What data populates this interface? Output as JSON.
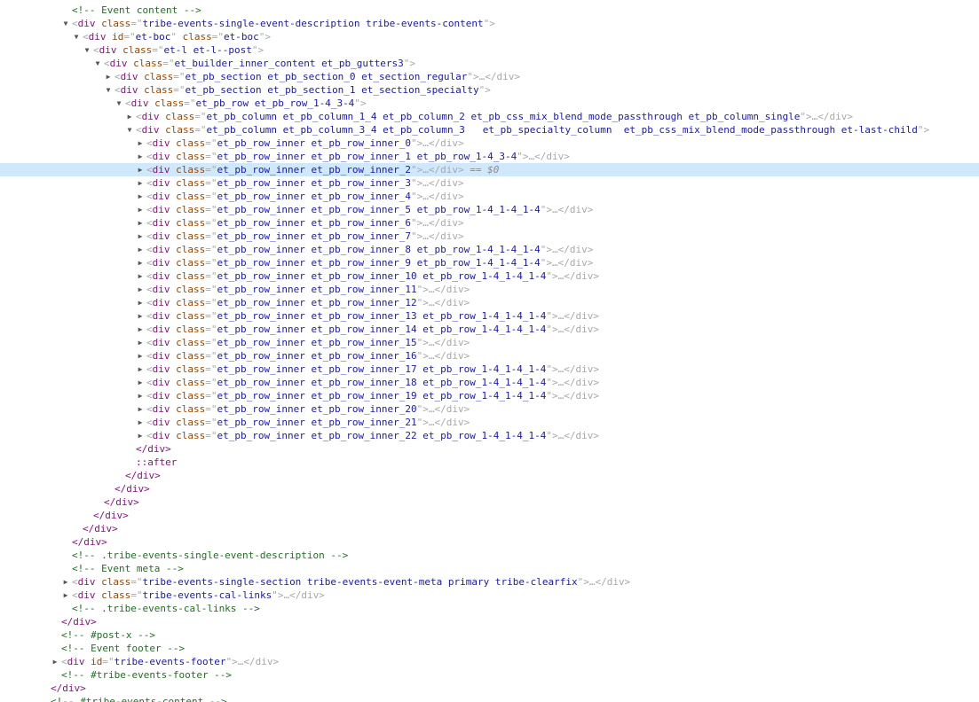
{
  "rows": [
    {
      "kind": "cm",
      "text": "<!-- Event content -->"
    },
    {
      "kind": "el",
      "toggle": "open",
      "tag": "div",
      "attrs": [
        {
          "n": "class",
          "v": "tribe-events-single-event-description tribe-events-content"
        }
      ],
      "end": ">"
    },
    {
      "kind": "el",
      "toggle": "open",
      "tag": "div",
      "attrs": [
        {
          "n": "id",
          "v": "et-boc"
        },
        {
          "n": "class",
          "v": "et-boc"
        }
      ],
      "end": ">"
    },
    {
      "kind": "el",
      "toggle": "open",
      "tag": "div",
      "attrs": [
        {
          "n": "class",
          "v": "et-l et-l--post"
        }
      ],
      "end": ">"
    },
    {
      "kind": "el",
      "toggle": "open",
      "tag": "div",
      "attrs": [
        {
          "n": "class",
          "v": "et_builder_inner_content et_pb_gutters3"
        }
      ],
      "end": ">"
    },
    {
      "kind": "el",
      "toggle": "closed",
      "tag": "div",
      "attrs": [
        {
          "n": "class",
          "v": "et_pb_section et_pb_section_0 et_section_regular"
        }
      ],
      "end": ">…</div>"
    },
    {
      "kind": "el",
      "toggle": "open",
      "tag": "div",
      "attrs": [
        {
          "n": "class",
          "v": "et_pb_section et_pb_section_1 et_section_specialty"
        }
      ],
      "end": ">"
    },
    {
      "kind": "el",
      "toggle": "open",
      "tag": "div",
      "attrs": [
        {
          "n": "class",
          "v": "et_pb_row et_pb_row_1-4_3-4"
        }
      ],
      "end": ">"
    },
    {
      "kind": "el",
      "toggle": "closed",
      "tag": "div",
      "attrs": [
        {
          "n": "class",
          "v": "et_pb_column et_pb_column_1_4 et_pb_column_2 et_pb_css_mix_blend_mode_passthrough et_pb_column_single"
        }
      ],
      "end": ">…</div>"
    },
    {
      "kind": "el",
      "toggle": "open",
      "tag": "div",
      "attrs": [
        {
          "n": "class",
          "v": "et_pb_column et_pb_column_3_4 et_pb_column_3   et_pb_specialty_column  et_pb_css_mix_blend_mode_passthrough et-last-child"
        }
      ],
      "end": ">"
    },
    {
      "kind": "el",
      "toggle": "closed",
      "tag": "div",
      "attrs": [
        {
          "n": "class",
          "v": "et_pb_row_inner et_pb_row_inner_0"
        }
      ],
      "end": ">…</div>"
    },
    {
      "kind": "el",
      "toggle": "closed",
      "tag": "div",
      "attrs": [
        {
          "n": "class",
          "v": "et_pb_row_inner et_pb_row_inner_1 et_pb_row_1-4_3-4"
        }
      ],
      "end": ">…</div>"
    },
    {
      "kind": "el",
      "toggle": "closed",
      "tag": "div",
      "attrs": [
        {
          "n": "class",
          "v": "et_pb_row_inner et_pb_row_inner_2"
        }
      ],
      "end": ">…</div>",
      "suffix": " == $0",
      "selected": true
    },
    {
      "kind": "el",
      "toggle": "closed",
      "tag": "div",
      "attrs": [
        {
          "n": "class",
          "v": "et_pb_row_inner et_pb_row_inner_3"
        }
      ],
      "end": ">…</div>"
    },
    {
      "kind": "el",
      "toggle": "closed",
      "tag": "div",
      "attrs": [
        {
          "n": "class",
          "v": "et_pb_row_inner et_pb_row_inner_4"
        }
      ],
      "end": ">…</div>"
    },
    {
      "kind": "el",
      "toggle": "closed",
      "tag": "div",
      "attrs": [
        {
          "n": "class",
          "v": "et_pb_row_inner et_pb_row_inner_5 et_pb_row_1-4_1-4_1-4"
        }
      ],
      "end": ">…</div>"
    },
    {
      "kind": "el",
      "toggle": "closed",
      "tag": "div",
      "attrs": [
        {
          "n": "class",
          "v": "et_pb_row_inner et_pb_row_inner_6"
        }
      ],
      "end": ">…</div>"
    },
    {
      "kind": "el",
      "toggle": "closed",
      "tag": "div",
      "attrs": [
        {
          "n": "class",
          "v": "et_pb_row_inner et_pb_row_inner_7"
        }
      ],
      "end": ">…</div>"
    },
    {
      "kind": "el",
      "toggle": "closed",
      "tag": "div",
      "attrs": [
        {
          "n": "class",
          "v": "et_pb_row_inner et_pb_row_inner_8 et_pb_row_1-4_1-4_1-4"
        }
      ],
      "end": ">…</div>"
    },
    {
      "kind": "el",
      "toggle": "closed",
      "tag": "div",
      "attrs": [
        {
          "n": "class",
          "v": "et_pb_row_inner et_pb_row_inner_9 et_pb_row_1-4_1-4_1-4"
        }
      ],
      "end": ">…</div>"
    },
    {
      "kind": "el",
      "toggle": "closed",
      "tag": "div",
      "attrs": [
        {
          "n": "class",
          "v": "et_pb_row_inner et_pb_row_inner_10 et_pb_row_1-4_1-4_1-4"
        }
      ],
      "end": ">…</div>"
    },
    {
      "kind": "el",
      "toggle": "closed",
      "tag": "div",
      "attrs": [
        {
          "n": "class",
          "v": "et_pb_row_inner et_pb_row_inner_11"
        }
      ],
      "end": ">…</div>"
    },
    {
      "kind": "el",
      "toggle": "closed",
      "tag": "div",
      "attrs": [
        {
          "n": "class",
          "v": "et_pb_row_inner et_pb_row_inner_12"
        }
      ],
      "end": ">…</div>"
    },
    {
      "kind": "el",
      "toggle": "closed",
      "tag": "div",
      "attrs": [
        {
          "n": "class",
          "v": "et_pb_row_inner et_pb_row_inner_13 et_pb_row_1-4_1-4_1-4"
        }
      ],
      "end": ">…</div>"
    },
    {
      "kind": "el",
      "toggle": "closed",
      "tag": "div",
      "attrs": [
        {
          "n": "class",
          "v": "et_pb_row_inner et_pb_row_inner_14 et_pb_row_1-4_1-4_1-4"
        }
      ],
      "end": ">…</div>"
    },
    {
      "kind": "el",
      "toggle": "closed",
      "tag": "div",
      "attrs": [
        {
          "n": "class",
          "v": "et_pb_row_inner et_pb_row_inner_15"
        }
      ],
      "end": ">…</div>"
    },
    {
      "kind": "el",
      "toggle": "closed",
      "tag": "div",
      "attrs": [
        {
          "n": "class",
          "v": "et_pb_row_inner et_pb_row_inner_16"
        }
      ],
      "end": ">…</div>"
    },
    {
      "kind": "el",
      "toggle": "closed",
      "tag": "div",
      "attrs": [
        {
          "n": "class",
          "v": "et_pb_row_inner et_pb_row_inner_17 et_pb_row_1-4_1-4_1-4"
        }
      ],
      "end": ">…</div>"
    },
    {
      "kind": "el",
      "toggle": "closed",
      "tag": "div",
      "attrs": [
        {
          "n": "class",
          "v": "et_pb_row_inner et_pb_row_inner_18 et_pb_row_1-4_1-4_1-4"
        }
      ],
      "end": ">…</div>"
    },
    {
      "kind": "el",
      "toggle": "closed",
      "tag": "div",
      "attrs": [
        {
          "n": "class",
          "v": "et_pb_row_inner et_pb_row_inner_19 et_pb_row_1-4_1-4_1-4"
        }
      ],
      "end": ">…</div>"
    },
    {
      "kind": "el",
      "toggle": "closed",
      "tag": "div",
      "attrs": [
        {
          "n": "class",
          "v": "et_pb_row_inner et_pb_row_inner_20"
        }
      ],
      "end": ">…</div>"
    },
    {
      "kind": "el",
      "toggle": "closed",
      "tag": "div",
      "attrs": [
        {
          "n": "class",
          "v": "et_pb_row_inner et_pb_row_inner_21"
        }
      ],
      "end": ">…</div>"
    },
    {
      "kind": "el",
      "toggle": "closed",
      "tag": "div",
      "attrs": [
        {
          "n": "class",
          "v": "et_pb_row_inner et_pb_row_inner_22 et_pb_row_1-4_1-4_1-4"
        }
      ],
      "end": ">…</div>"
    },
    {
      "kind": "close",
      "text": "</div>"
    },
    {
      "kind": "pseudo",
      "text": "::after"
    },
    {
      "kind": "close",
      "text": "</div>"
    },
    {
      "kind": "close",
      "text": "</div>"
    },
    {
      "kind": "close",
      "text": "</div>"
    },
    {
      "kind": "close",
      "text": "</div>"
    },
    {
      "kind": "close",
      "text": "</div>"
    },
    {
      "kind": "close",
      "text": "</div>"
    },
    {
      "kind": "cm",
      "text": "<!-- .tribe-events-single-event-description -->"
    },
    {
      "kind": "cm",
      "text": "<!-- Event meta -->"
    },
    {
      "kind": "el",
      "toggle": "closed",
      "tag": "div",
      "attrs": [
        {
          "n": "class",
          "v": "tribe-events-single-section tribe-events-event-meta primary tribe-clearfix"
        }
      ],
      "end": ">…</div>"
    },
    {
      "kind": "el",
      "toggle": "closed",
      "tag": "div",
      "attrs": [
        {
          "n": "class",
          "v": "tribe-events-cal-links"
        }
      ],
      "end": ">…</div>"
    },
    {
      "kind": "cm",
      "text": "<!-- .tribe-events-cal-links -->"
    },
    {
      "kind": "close",
      "text": "</div>"
    },
    {
      "kind": "cm",
      "text": "<!-- #post-x -->"
    },
    {
      "kind": "cm",
      "text": "<!-- Event footer -->"
    },
    {
      "kind": "el",
      "toggle": "closed",
      "tag": "div",
      "attrs": [
        {
          "n": "id",
          "v": "tribe-events-footer"
        }
      ],
      "end": ">…</div>"
    },
    {
      "kind": "cm",
      "text": "<!-- #tribe-events-footer -->"
    },
    {
      "kind": "close",
      "text": "</div>"
    },
    {
      "kind": "cm",
      "text": "<!-- #tribe-events-content -->"
    }
  ]
}
